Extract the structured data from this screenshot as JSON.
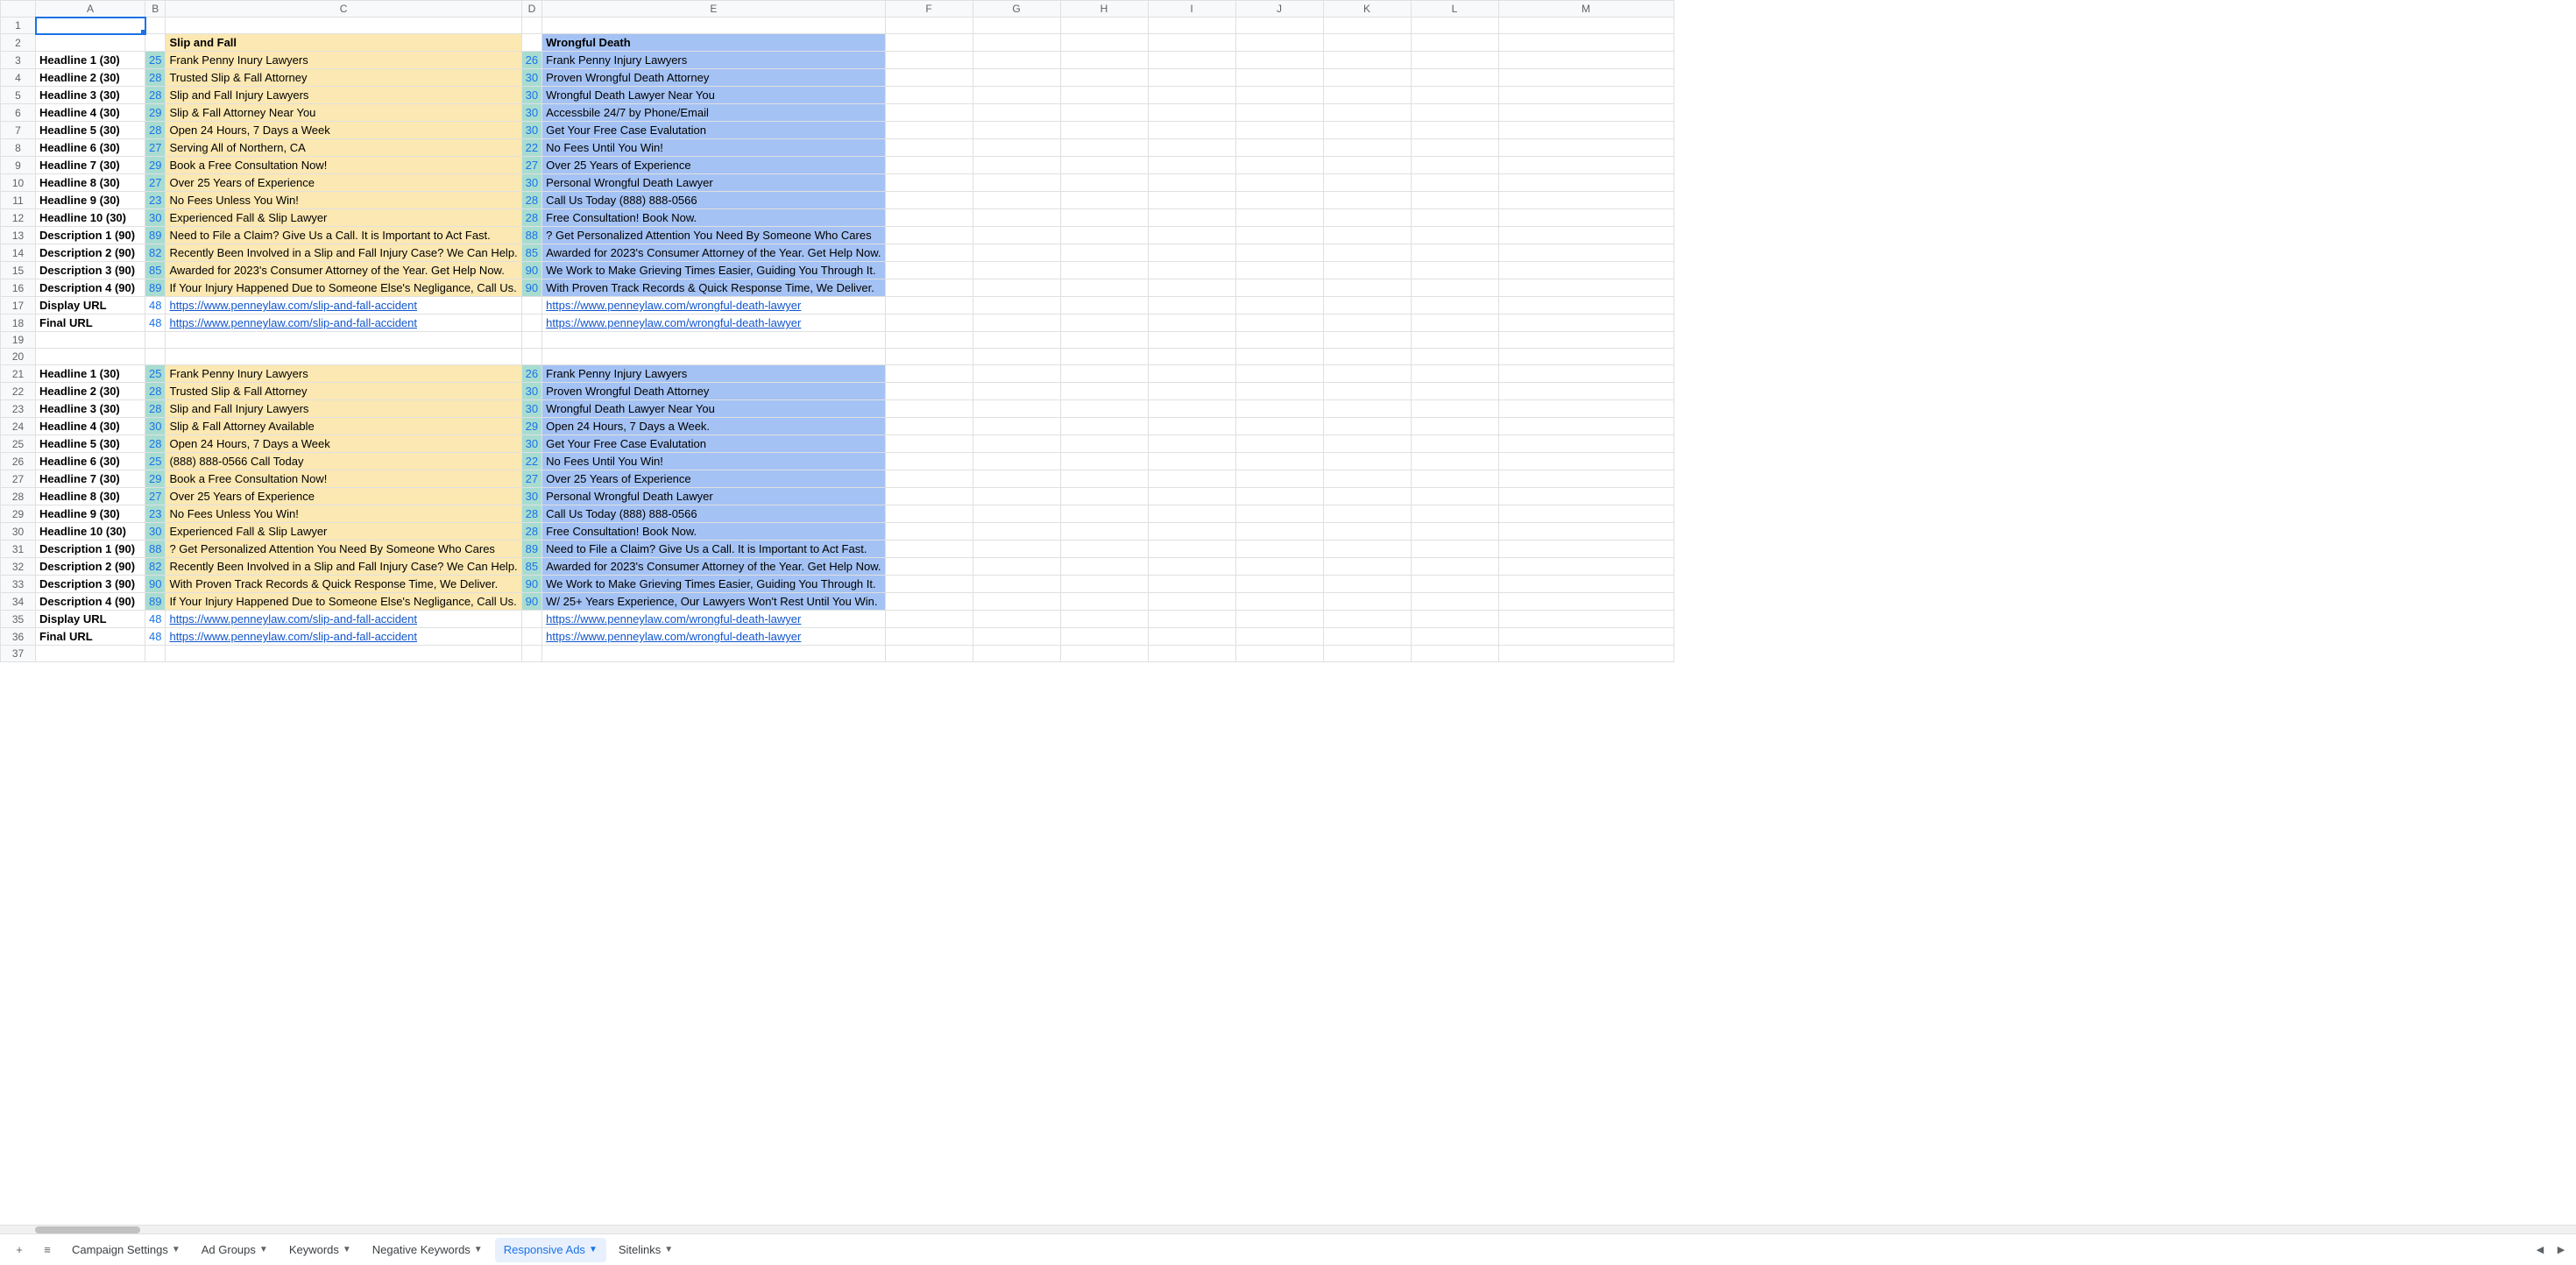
{
  "columns": [
    "A",
    "B",
    "C",
    "D",
    "E",
    "F",
    "G",
    "H",
    "I",
    "J",
    "K",
    "L",
    "M"
  ],
  "row_count": 37,
  "active_cell": "A1",
  "rows": [
    {
      "r": 1,
      "cells": {}
    },
    {
      "r": 2,
      "cells": {
        "C": {
          "t": "Slip and Fall",
          "bg": "yellow",
          "bold": true
        },
        "E": {
          "t": "Wrongful Death",
          "bg": "blue",
          "bold": true
        }
      }
    },
    {
      "r": 3,
      "cells": {
        "A": {
          "t": "Headline 1 (30)",
          "bold": true
        },
        "B": {
          "t": "25",
          "bg": "mint",
          "num": true
        },
        "C": {
          "t": "Frank Penny Inury Lawyers",
          "bg": "yellow"
        },
        "D": {
          "t": "26",
          "bg": "mint",
          "num": true
        },
        "E": {
          "t": "Frank Penny Injury Lawyers",
          "bg": "blue"
        }
      }
    },
    {
      "r": 4,
      "cells": {
        "A": {
          "t": "Headline 2 (30)",
          "bold": true
        },
        "B": {
          "t": "28",
          "bg": "mint",
          "num": true
        },
        "C": {
          "t": "Trusted Slip & Fall Attorney",
          "bg": "yellow"
        },
        "D": {
          "t": "30",
          "bg": "mint",
          "num": true
        },
        "E": {
          "t": "Proven Wrongful Death Attorney",
          "bg": "blue"
        }
      }
    },
    {
      "r": 5,
      "cells": {
        "A": {
          "t": "Headline 3 (30)",
          "bold": true
        },
        "B": {
          "t": "28",
          "bg": "mint",
          "num": true
        },
        "C": {
          "t": "Slip and Fall Injury Lawyers",
          "bg": "yellow"
        },
        "D": {
          "t": "30",
          "bg": "mint",
          "num": true
        },
        "E": {
          "t": "Wrongful Death Lawyer Near You",
          "bg": "blue"
        }
      }
    },
    {
      "r": 6,
      "cells": {
        "A": {
          "t": "Headline 4 (30)",
          "bold": true
        },
        "B": {
          "t": "29",
          "bg": "mint",
          "num": true
        },
        "C": {
          "t": "Slip & Fall Attorney Near You",
          "bg": "yellow"
        },
        "D": {
          "t": "30",
          "bg": "mint",
          "num": true
        },
        "E": {
          "t": "Accessbile 24/7 by Phone/Email",
          "bg": "blue"
        }
      }
    },
    {
      "r": 7,
      "cells": {
        "A": {
          "t": "Headline 5 (30)",
          "bold": true
        },
        "B": {
          "t": "28",
          "bg": "mint",
          "num": true
        },
        "C": {
          "t": "Open 24 Hours, 7 Days a Week",
          "bg": "yellow"
        },
        "D": {
          "t": "30",
          "bg": "mint",
          "num": true
        },
        "E": {
          "t": "Get Your Free Case Evalutation",
          "bg": "blue"
        }
      }
    },
    {
      "r": 8,
      "cells": {
        "A": {
          "t": "Headline 6 (30)",
          "bold": true
        },
        "B": {
          "t": "27",
          "bg": "mint",
          "num": true
        },
        "C": {
          "t": "Serving All of Northern, CA",
          "bg": "yellow"
        },
        "D": {
          "t": "22",
          "bg": "mint",
          "num": true
        },
        "E": {
          "t": "No Fees Until You Win!",
          "bg": "blue"
        }
      }
    },
    {
      "r": 9,
      "cells": {
        "A": {
          "t": "Headline 7 (30)",
          "bold": true
        },
        "B": {
          "t": "29",
          "bg": "mint",
          "num": true
        },
        "C": {
          "t": "Book a Free Consultation Now!",
          "bg": "yellow"
        },
        "D": {
          "t": "27",
          "bg": "mint",
          "num": true
        },
        "E": {
          "t": "Over 25 Years of Experience",
          "bg": "blue"
        }
      }
    },
    {
      "r": 10,
      "cells": {
        "A": {
          "t": "Headline 8 (30)",
          "bold": true
        },
        "B": {
          "t": "27",
          "bg": "mint",
          "num": true
        },
        "C": {
          "t": "Over 25 Years of Experience",
          "bg": "yellow"
        },
        "D": {
          "t": "30",
          "bg": "mint",
          "num": true
        },
        "E": {
          "t": "Personal Wrongful Death Lawyer",
          "bg": "blue"
        }
      }
    },
    {
      "r": 11,
      "cells": {
        "A": {
          "t": "Headline 9 (30)",
          "bold": true
        },
        "B": {
          "t": "23",
          "bg": "mint",
          "num": true
        },
        "C": {
          "t": "No Fees Unless You Win!",
          "bg": "yellow"
        },
        "D": {
          "t": "28",
          "bg": "mint",
          "num": true
        },
        "E": {
          "t": "Call Us Today (888) 888-0566",
          "bg": "blue"
        }
      }
    },
    {
      "r": 12,
      "cells": {
        "A": {
          "t": "Headline 10 (30)",
          "bold": true
        },
        "B": {
          "t": "30",
          "bg": "mint",
          "num": true
        },
        "C": {
          "t": "Experienced Fall & Slip Lawyer",
          "bg": "yellow"
        },
        "D": {
          "t": "28",
          "bg": "mint",
          "num": true
        },
        "E": {
          "t": "Free Consultation! Book Now.",
          "bg": "blue"
        }
      }
    },
    {
      "r": 13,
      "cells": {
        "A": {
          "t": "Description 1 (90)",
          "bold": true
        },
        "B": {
          "t": "89",
          "bg": "mint",
          "num": true
        },
        "C": {
          "t": "Need to File a Claim? Give Us a Call. It is Important to Act Fast.",
          "bg": "yellow"
        },
        "D": {
          "t": "88",
          "bg": "mint",
          "num": true
        },
        "E": {
          "t": "? Get Personalized Attention You Need By Someone Who Cares",
          "bg": "blue"
        }
      }
    },
    {
      "r": 14,
      "cells": {
        "A": {
          "t": "Description 2 (90)",
          "bold": true
        },
        "B": {
          "t": "82",
          "bg": "mint",
          "num": true
        },
        "C": {
          "t": "Recently Been Involved in a Slip and Fall Injury Case? We Can Help.",
          "bg": "yellow"
        },
        "D": {
          "t": "85",
          "bg": "mint",
          "num": true
        },
        "E": {
          "t": "Awarded for 2023's Consumer Attorney of the Year. Get Help Now.",
          "bg": "blue"
        }
      }
    },
    {
      "r": 15,
      "cells": {
        "A": {
          "t": "Description 3 (90)",
          "bold": true
        },
        "B": {
          "t": "85",
          "bg": "mint",
          "num": true
        },
        "C": {
          "t": "Awarded for 2023's Consumer Attorney of the Year. Get Help Now.",
          "bg": "yellow"
        },
        "D": {
          "t": "90",
          "bg": "mint",
          "num": true
        },
        "E": {
          "t": "We Work to Make Grieving Times Easier, Guiding You Through It.",
          "bg": "blue"
        }
      }
    },
    {
      "r": 16,
      "cells": {
        "A": {
          "t": "Description 4 (90)",
          "bold": true
        },
        "B": {
          "t": "89",
          "bg": "mint",
          "num": true
        },
        "C": {
          "t": "If Your Injury Happened Due to Someone Else's Negligance, Call Us.",
          "bg": "yellow"
        },
        "D": {
          "t": "90",
          "bg": "mint",
          "num": true
        },
        "E": {
          "t": "With Proven Track Records & Quick Response Time, We Deliver.",
          "bg": "blue"
        }
      }
    },
    {
      "r": 17,
      "cells": {
        "A": {
          "t": "Display URL",
          "bold": true
        },
        "B": {
          "t": "48",
          "num": true
        },
        "C": {
          "t": "https://www.penneylaw.com/slip-and-fall-accident",
          "link": true
        },
        "E": {
          "t": "https://www.penneylaw.com/wrongful-death-lawyer",
          "link": true
        }
      }
    },
    {
      "r": 18,
      "cells": {
        "A": {
          "t": "Final URL",
          "bold": true
        },
        "B": {
          "t": "48",
          "num": true
        },
        "C": {
          "t": "https://www.penneylaw.com/slip-and-fall-accident",
          "link": true
        },
        "E": {
          "t": "https://www.penneylaw.com/wrongful-death-lawyer",
          "link": true
        }
      }
    },
    {
      "r": 19,
      "cells": {}
    },
    {
      "r": 20,
      "cells": {}
    },
    {
      "r": 21,
      "cells": {
        "A": {
          "t": "Headline 1 (30)",
          "bold": true
        },
        "B": {
          "t": "25",
          "bg": "mint",
          "num": true
        },
        "C": {
          "t": "Frank Penny Inury Lawyers",
          "bg": "yellow"
        },
        "D": {
          "t": "26",
          "bg": "mint",
          "num": true
        },
        "E": {
          "t": "Frank Penny Injury Lawyers",
          "bg": "blue"
        }
      }
    },
    {
      "r": 22,
      "cells": {
        "A": {
          "t": "Headline 2 (30)",
          "bold": true
        },
        "B": {
          "t": "28",
          "bg": "mint",
          "num": true
        },
        "C": {
          "t": "Trusted Slip & Fall Attorney",
          "bg": "yellow"
        },
        "D": {
          "t": "30",
          "bg": "mint",
          "num": true
        },
        "E": {
          "t": "Proven Wrongful Death Attorney",
          "bg": "blue"
        }
      }
    },
    {
      "r": 23,
      "cells": {
        "A": {
          "t": "Headline 3 (30)",
          "bold": true
        },
        "B": {
          "t": "28",
          "bg": "mint",
          "num": true
        },
        "C": {
          "t": "Slip and Fall Injury Lawyers",
          "bg": "yellow"
        },
        "D": {
          "t": "30",
          "bg": "mint",
          "num": true
        },
        "E": {
          "t": "Wrongful Death Lawyer Near You",
          "bg": "blue"
        }
      }
    },
    {
      "r": 24,
      "cells": {
        "A": {
          "t": "Headline 4 (30)",
          "bold": true
        },
        "B": {
          "t": "30",
          "bg": "mint",
          "num": true
        },
        "C": {
          "t": "Slip & Fall Attorney Available",
          "bg": "yellow"
        },
        "D": {
          "t": "29",
          "bg": "mint",
          "num": true
        },
        "E": {
          "t": "Open 24 Hours, 7 Days a Week.",
          "bg": "blue"
        }
      }
    },
    {
      "r": 25,
      "cells": {
        "A": {
          "t": "Headline 5 (30)",
          "bold": true
        },
        "B": {
          "t": "28",
          "bg": "mint",
          "num": true
        },
        "C": {
          "t": "Open 24 Hours, 7 Days a Week",
          "bg": "yellow"
        },
        "D": {
          "t": "30",
          "bg": "mint",
          "num": true
        },
        "E": {
          "t": "Get Your Free Case Evalutation",
          "bg": "blue"
        }
      }
    },
    {
      "r": 26,
      "cells": {
        "A": {
          "t": "Headline 6 (30)",
          "bold": true
        },
        "B": {
          "t": "25",
          "bg": "mint",
          "num": true
        },
        "C": {
          "t": "(888) 888-0566 Call Today",
          "bg": "yellow"
        },
        "D": {
          "t": "22",
          "bg": "mint",
          "num": true
        },
        "E": {
          "t": "No Fees Until You Win!",
          "bg": "blue"
        }
      }
    },
    {
      "r": 27,
      "cells": {
        "A": {
          "t": "Headline 7 (30)",
          "bold": true
        },
        "B": {
          "t": "29",
          "bg": "mint",
          "num": true
        },
        "C": {
          "t": "Book a Free Consultation Now!",
          "bg": "yellow"
        },
        "D": {
          "t": "27",
          "bg": "mint",
          "num": true
        },
        "E": {
          "t": "Over 25 Years of Experience",
          "bg": "blue"
        }
      }
    },
    {
      "r": 28,
      "cells": {
        "A": {
          "t": "Headline 8 (30)",
          "bold": true
        },
        "B": {
          "t": "27",
          "bg": "mint",
          "num": true
        },
        "C": {
          "t": "Over 25 Years of Experience",
          "bg": "yellow"
        },
        "D": {
          "t": "30",
          "bg": "mint",
          "num": true
        },
        "E": {
          "t": "Personal Wrongful Death Lawyer",
          "bg": "blue"
        }
      }
    },
    {
      "r": 29,
      "cells": {
        "A": {
          "t": "Headline 9 (30)",
          "bold": true
        },
        "B": {
          "t": "23",
          "bg": "mint",
          "num": true
        },
        "C": {
          "t": "No Fees Unless You Win!",
          "bg": "yellow"
        },
        "D": {
          "t": "28",
          "bg": "mint",
          "num": true
        },
        "E": {
          "t": "Call Us Today (888) 888-0566",
          "bg": "blue"
        }
      }
    },
    {
      "r": 30,
      "cells": {
        "A": {
          "t": "Headline 10 (30)",
          "bold": true
        },
        "B": {
          "t": "30",
          "bg": "mint",
          "num": true
        },
        "C": {
          "t": "Experienced Fall & Slip Lawyer",
          "bg": "yellow"
        },
        "D": {
          "t": "28",
          "bg": "mint",
          "num": true
        },
        "E": {
          "t": "Free Consultation! Book Now.",
          "bg": "blue"
        }
      }
    },
    {
      "r": 31,
      "cells": {
        "A": {
          "t": "Description 1 (90)",
          "bold": true
        },
        "B": {
          "t": "88",
          "bg": "mint",
          "num": true
        },
        "C": {
          "t": "? Get Personalized Attention You Need By Someone Who Cares",
          "bg": "yellow"
        },
        "D": {
          "t": "89",
          "bg": "mint",
          "num": true
        },
        "E": {
          "t": "Need to File a Claim? Give Us a Call. It is Important to Act Fast.",
          "bg": "blue"
        }
      }
    },
    {
      "r": 32,
      "cells": {
        "A": {
          "t": "Description 2 (90)",
          "bold": true
        },
        "B": {
          "t": "82",
          "bg": "mint",
          "num": true
        },
        "C": {
          "t": "Recently Been Involved in a Slip and Fall Injury Case? We Can Help.",
          "bg": "yellow"
        },
        "D": {
          "t": "85",
          "bg": "mint",
          "num": true
        },
        "E": {
          "t": "Awarded for 2023's Consumer Attorney of the Year. Get Help Now.",
          "bg": "blue"
        }
      }
    },
    {
      "r": 33,
      "cells": {
        "A": {
          "t": "Description 3 (90)",
          "bold": true
        },
        "B": {
          "t": "90",
          "bg": "mint",
          "num": true
        },
        "C": {
          "t": "With Proven Track Records & Quick Response Time, We Deliver.",
          "bg": "yellow"
        },
        "D": {
          "t": "90",
          "bg": "mint",
          "num": true
        },
        "E": {
          "t": "We Work to Make Grieving Times Easier, Guiding You Through It.",
          "bg": "blue"
        }
      }
    },
    {
      "r": 34,
      "cells": {
        "A": {
          "t": "Description 4 (90)",
          "bold": true
        },
        "B": {
          "t": "89",
          "bg": "mint",
          "num": true
        },
        "C": {
          "t": "If Your Injury Happened Due to Someone Else's Negligance, Call Us.",
          "bg": "yellow"
        },
        "D": {
          "t": "90",
          "bg": "mint",
          "num": true
        },
        "E": {
          "t": "W/ 25+ Years Experience, Our Lawyers Won't Rest Until You Win.",
          "bg": "blue"
        }
      }
    },
    {
      "r": 35,
      "cells": {
        "A": {
          "t": "Display URL",
          "bold": true
        },
        "B": {
          "t": "48",
          "num": true
        },
        "C": {
          "t": "https://www.penneylaw.com/slip-and-fall-accident",
          "link": true
        },
        "E": {
          "t": "https://www.penneylaw.com/wrongful-death-lawyer",
          "link": true
        }
      }
    },
    {
      "r": 36,
      "cells": {
        "A": {
          "t": "Final URL",
          "bold": true
        },
        "B": {
          "t": "48",
          "num": true
        },
        "C": {
          "t": "https://www.penneylaw.com/slip-and-fall-accident",
          "link": true
        },
        "E": {
          "t": "https://www.penneylaw.com/wrongful-death-lawyer",
          "link": true
        }
      }
    },
    {
      "r": 37,
      "cells": {}
    }
  ],
  "tabs": [
    {
      "label": "Campaign Settings",
      "active": false
    },
    {
      "label": "Ad Groups",
      "active": false
    },
    {
      "label": "Keywords",
      "active": false
    },
    {
      "label": "Negative Keywords",
      "active": false
    },
    {
      "label": "Responsive Ads",
      "active": true
    },
    {
      "label": "Sitelinks",
      "active": false
    }
  ],
  "icons": {
    "plus": "+",
    "menu": "≡",
    "caret": "▼",
    "left": "◀",
    "right": "▶"
  }
}
